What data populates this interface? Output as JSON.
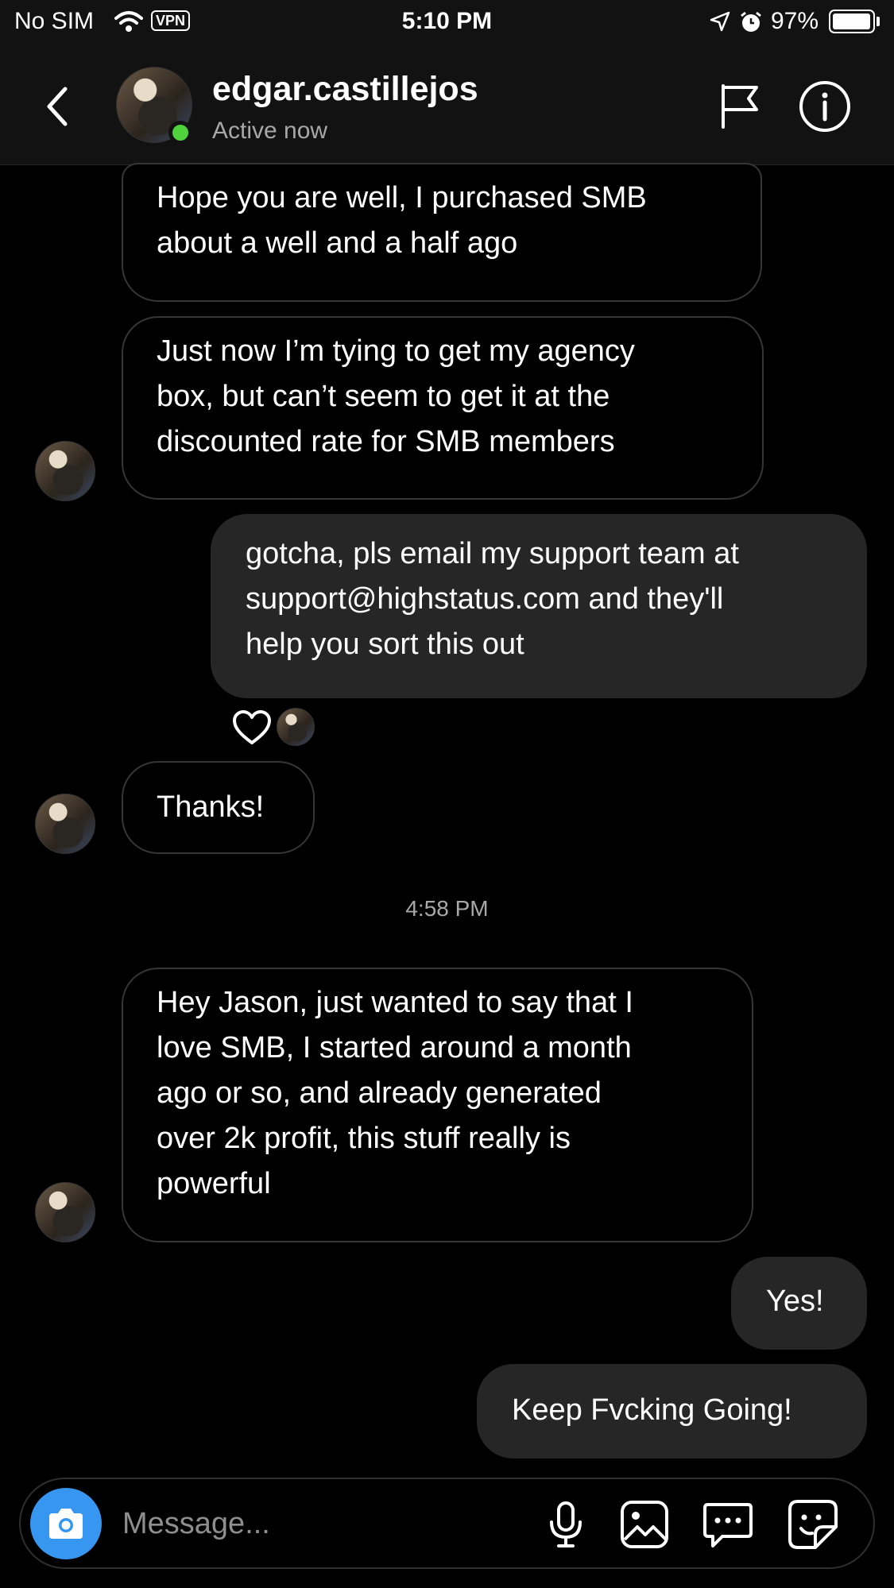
{
  "status_bar": {
    "carrier": "No SIM",
    "vpn": "VPN",
    "time": "5:10 PM",
    "battery_percent": "97%",
    "battery_level": 0.97
  },
  "header": {
    "username": "edgar.castillejos",
    "status": "Active now"
  },
  "messages": [
    {
      "direction": "incoming",
      "text": "Hope you are well, I purchased SMB\nabout a well and a half ago"
    },
    {
      "direction": "incoming",
      "text": "Just now I’m tying to get my agency\nbox, but can’t seem to get it at the\ndiscounted rate for SMB members"
    },
    {
      "direction": "outgoing",
      "text": "gotcha, pls email my support team at\nsupport@highstatus.com and they'll\nhelp you sort this out"
    },
    {
      "direction": "incoming",
      "text": "Thanks!"
    },
    {
      "direction": "incoming",
      "text": "Hey Jason, just wanted to say that I\nlove SMB, I started around a month\nago or so, and already generated\nover 2k profit, this stuff really is\npowerful"
    },
    {
      "direction": "outgoing",
      "text": "Yes!"
    },
    {
      "direction": "outgoing",
      "text": "Keep Fvcking Going!"
    }
  ],
  "timestamp": "4:58 PM",
  "composer": {
    "placeholder": "Message..."
  },
  "colors": {
    "accent": "#3797f0",
    "active_dot": "#4fd23b",
    "outgoing_bubble": "#262626",
    "background": "#000000"
  },
  "icons": [
    "wifi-icon",
    "location-icon",
    "alarm-icon",
    "back-icon",
    "flag-icon",
    "info-icon",
    "heart-icon",
    "camera-icon",
    "microphone-icon",
    "gallery-icon",
    "chat-bubble-icon",
    "sticker-icon"
  ]
}
